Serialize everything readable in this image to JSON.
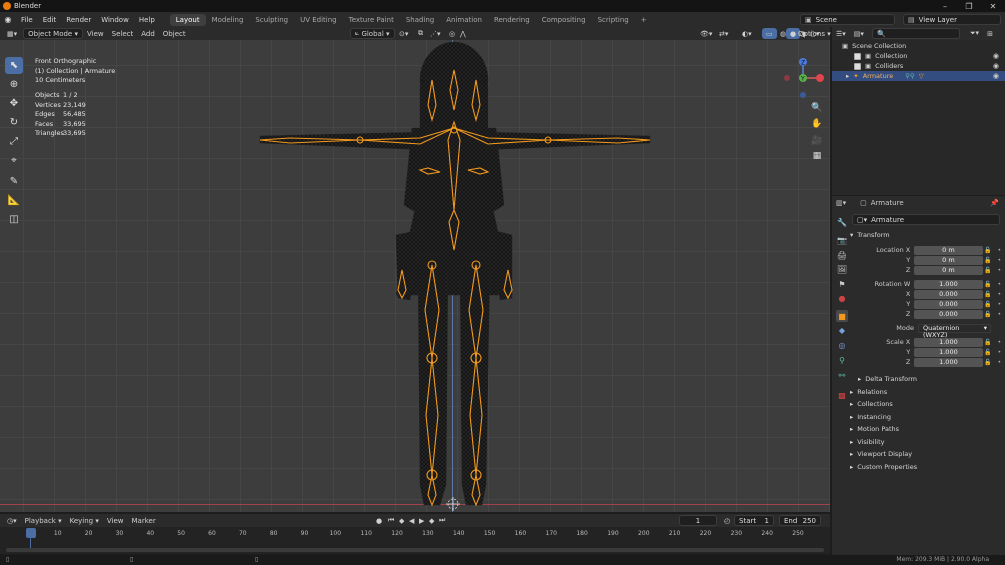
{
  "window": {
    "title": "Blender"
  },
  "menu": [
    "File",
    "Edit",
    "Render",
    "Window",
    "Help"
  ],
  "workspaces": [
    {
      "label": "Layout",
      "active": true
    },
    {
      "label": "Modeling",
      "active": false
    },
    {
      "label": "Sculpting",
      "active": false
    },
    {
      "label": "UV Editing",
      "active": false
    },
    {
      "label": "Texture Paint",
      "active": false
    },
    {
      "label": "Shading",
      "active": false
    },
    {
      "label": "Animation",
      "active": false
    },
    {
      "label": "Rendering",
      "active": false
    },
    {
      "label": "Compositing",
      "active": false
    },
    {
      "label": "Scripting",
      "active": false
    }
  ],
  "scene": {
    "name": "Scene",
    "view_layer": "View Layer"
  },
  "viewport_header": {
    "mode": "Object Mode",
    "menus": [
      "View",
      "Select",
      "Add",
      "Object"
    ],
    "transform_orientation": "Global",
    "options_label": "Options"
  },
  "viewport_overlay": {
    "view_name": "Front Orthographic",
    "collection_path": "(1) Collection | Armature",
    "scale": "10 Centimeters",
    "stats": [
      {
        "label": "Objects",
        "value": "1 / 2"
      },
      {
        "label": "Vertices",
        "value": "23,149"
      },
      {
        "label": "Edges",
        "value": "56,485"
      },
      {
        "label": "Faces",
        "value": "33,695"
      },
      {
        "label": "Triangles",
        "value": "33,695"
      }
    ]
  },
  "gizmo": {
    "z": "Z",
    "y": "Y"
  },
  "outliner": {
    "root": "Scene Collection",
    "items": [
      {
        "label": "Collection",
        "selected": false
      },
      {
        "label": "Colliders",
        "selected": false
      },
      {
        "label": "Armature",
        "selected": true
      }
    ]
  },
  "properties": {
    "object_name": "Armature",
    "datablock_name": "Armature",
    "transform_title": "Transform",
    "location": {
      "x": "0 m",
      "y": "0 m",
      "z": "0 m"
    },
    "rotation": {
      "w": "1.000",
      "x": "0.000",
      "y": "0.000",
      "z": "0.000"
    },
    "mode_label": "Mode",
    "mode_value": "Quaternion (WXYZ)",
    "scale": {
      "x": "1.000",
      "y": "1.000",
      "z": "1.000"
    },
    "labels": {
      "location_x": "Location X",
      "y": "Y",
      "z": "Z",
      "rotation_w": "Rotation W",
      "x": "X",
      "scale_x": "Scale X"
    },
    "delta_transform": "Delta Transform",
    "panels": [
      "Relations",
      "Collections",
      "Instancing",
      "Motion Paths",
      "Visibility",
      "Viewport Display",
      "Custom Properties"
    ]
  },
  "timeline": {
    "menus": [
      "Playback",
      "Keying",
      "View",
      "Marker"
    ],
    "current_frame": "1",
    "start_label": "Start",
    "start": "1",
    "end_label": "End",
    "end": "250",
    "ticks": [
      "1",
      "10",
      "20",
      "30",
      "40",
      "50",
      "60",
      "70",
      "80",
      "90",
      "100",
      "110",
      "120",
      "130",
      "140",
      "150",
      "160",
      "170",
      "180",
      "190",
      "200",
      "210",
      "220",
      "230",
      "240",
      "250"
    ]
  },
  "status": {
    "text": "Mem: 209.3 MiB | 2.90.0 Alpha"
  },
  "colors": {
    "accent": "#4b6fa5",
    "bone": "#f39a1e",
    "selection": "#334d80"
  }
}
